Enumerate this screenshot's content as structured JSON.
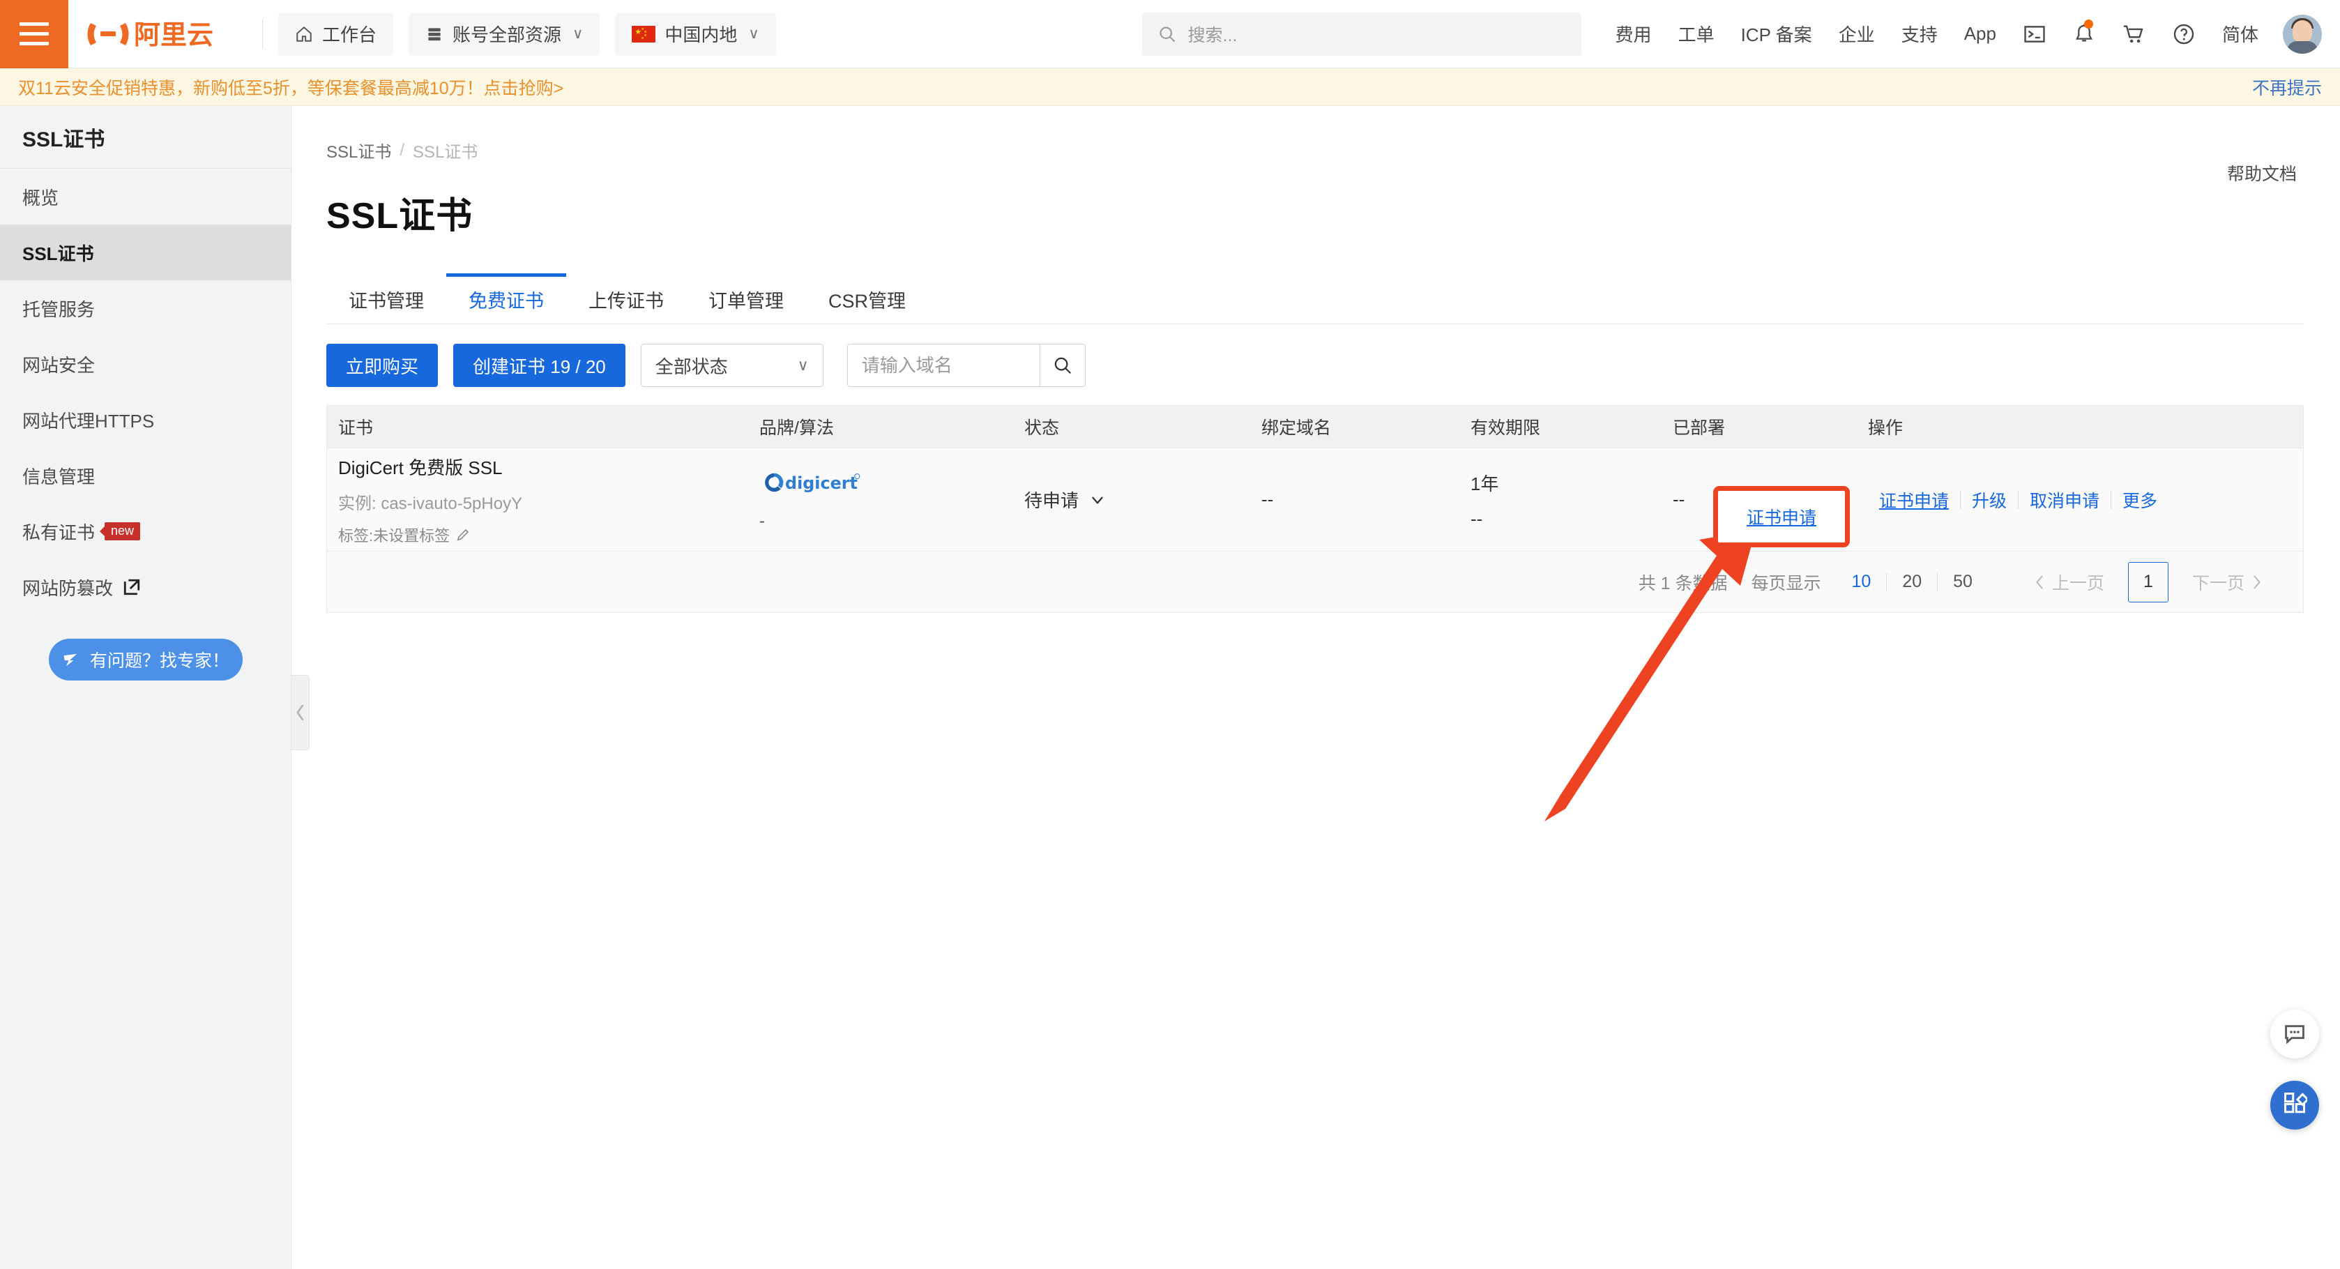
{
  "header": {
    "menu_icon": "hamburger-icon",
    "logo_text": "阿里云",
    "workbench": {
      "label": "工作台",
      "icon": "home-icon"
    },
    "resources": {
      "label": "账号全部资源",
      "icon": "server-icon",
      "caret": "∨"
    },
    "region": {
      "label": "中国内地",
      "icon": "cn-flag-icon",
      "caret": "∨"
    },
    "search": {
      "placeholder": "搜索...",
      "icon": "search-icon"
    },
    "nav_links": [
      "费用",
      "工单",
      "ICP 备案",
      "企业",
      "支持",
      "App"
    ],
    "icons": [
      "terminal-icon",
      "bell-icon",
      "cart-icon",
      "help-circle-icon"
    ],
    "language": "简体",
    "avatar": "user-avatar"
  },
  "promo": {
    "text": "双11云安全促销特惠，新购低至5折，等保套餐最高减10万！点击抢购>",
    "dismiss": "不再提示",
    "color": "#e8912d"
  },
  "sidebar": {
    "title": "SSL证书",
    "items": [
      {
        "label": "概览",
        "active": false
      },
      {
        "label": "SSL证书",
        "active": true
      },
      {
        "label": "托管服务",
        "active": false
      },
      {
        "label": "网站安全",
        "active": false
      },
      {
        "label": "网站代理HTTPS",
        "active": false
      },
      {
        "label": "信息管理",
        "active": false
      },
      {
        "label": "私有证书",
        "active": false,
        "badge": "new"
      },
      {
        "label": "网站防篡改",
        "active": false,
        "external": true
      }
    ],
    "expert_button": "有问题？找专家！",
    "collapse_icon": "chevron-left-icon"
  },
  "main": {
    "breadcrumb": {
      "first": "SSL证书",
      "sep": "/",
      "current": "SSL证书"
    },
    "page_title": "SSL证书",
    "help_doc": "帮助文档",
    "tabs": [
      {
        "label": "证书管理",
        "active": false
      },
      {
        "label": "免费证书",
        "active": true
      },
      {
        "label": "上传证书",
        "active": false
      },
      {
        "label": "订单管理",
        "active": false
      },
      {
        "label": "CSR管理",
        "active": false
      }
    ],
    "toolbar": {
      "buy_now": "立即购买",
      "create_cert": "创建证书 19 / 20",
      "status_filter": "全部状态",
      "status_caret": "∨",
      "domain_placeholder": "请输入域名",
      "search_icon": "search-icon"
    },
    "table": {
      "columns": [
        "证书",
        "品牌/算法",
        "状态",
        "绑定域名",
        "有效期限",
        "已部署",
        "操作"
      ],
      "rows": [
        {
          "cert_name": "DigiCert 免费版 SSL",
          "cert_instance": "实例: cas-ivauto-5pHoyY",
          "cert_tag": "标签:未设置标签",
          "tag_edit_icon": "pencil-icon",
          "brand_logo": "digicert-logo",
          "brand_algorithm": "-",
          "status": "待申请",
          "status_caret": "∨",
          "bound_domain": "--",
          "validity": "1年",
          "validity_sub": "--",
          "deployed": "--",
          "actions": [
            "证书申请",
            "升级",
            "取消申请",
            "更多"
          ]
        }
      ]
    },
    "pagination": {
      "total": "共 1 条数据",
      "per_page_label": "每页显示",
      "sizes": [
        "10",
        "20",
        "50"
      ],
      "active_size": "10",
      "prev": "上一页",
      "next": "下一页",
      "current_page": "1"
    }
  },
  "annotation": {
    "highlight_target": "证书申请",
    "highlight_color": "#ee4323",
    "arrow_color": "#ee4323"
  },
  "floating": {
    "chat": "chat-bubble-icon",
    "apps": "apps-grid-icon"
  },
  "colors": {
    "brand_orange": "#ee6a23",
    "primary_blue": "#1668dc",
    "link_blue": "#3b72c2"
  }
}
